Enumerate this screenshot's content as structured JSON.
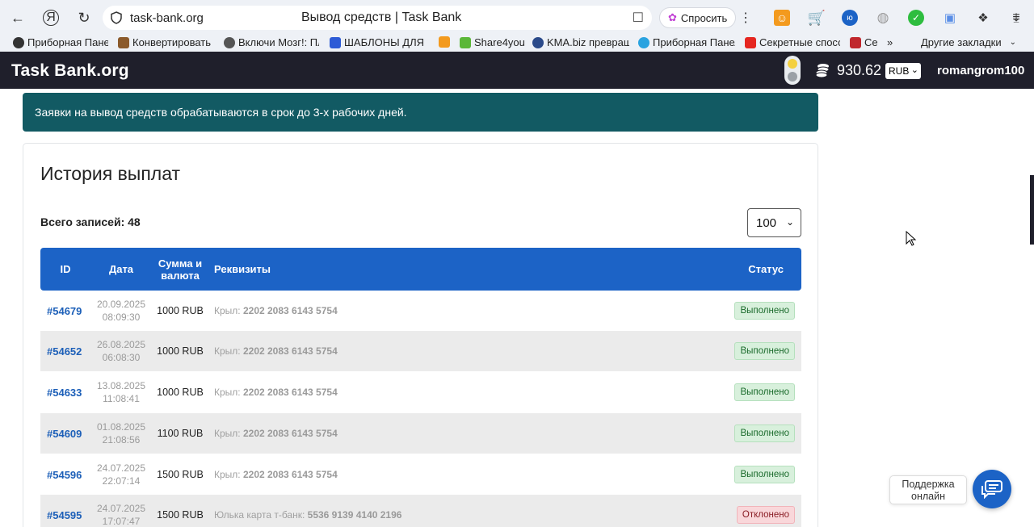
{
  "browser": {
    "url": "task-bank.org",
    "page_title": "Вывод средств | Task Bank",
    "ask_label": "Спросить",
    "bookmarks": [
      {
        "label": "Приборная Панел",
        "color": "#333333"
      },
      {
        "label": "Конвертировать",
        "color": "#8b5a2b"
      },
      {
        "label": "Включи Мозг!: Пл",
        "color": "#555555"
      },
      {
        "label": "ШАБЛОНЫ ДЛЯ Р",
        "color": "#2d5bd6"
      },
      {
        "label": "",
        "color": "#f39a1e"
      },
      {
        "label": "Share4you",
        "color": "#5bb738"
      },
      {
        "label": "KMA.biz превращ",
        "color": "#2b4a8a"
      },
      {
        "label": "Приборная Панел",
        "color": "#2aa3e0"
      },
      {
        "label": "Секретные спосо",
        "color": "#e52620"
      },
      {
        "label": "Се",
        "color": "#c0272d"
      }
    ],
    "more_bookmarks_label": "»",
    "other_bookmarks": "Другие закладки"
  },
  "header": {
    "logo": "Task Bank.org",
    "balance": "930.62",
    "currency": "RUB",
    "username": "romangrom100"
  },
  "alert": "Заявки на вывод средств обрабатываются в срок до 3-х рабочих дней.",
  "history": {
    "title": "История выплат",
    "total": "Всего записей: 48",
    "per_page": "100",
    "columns": {
      "id": "ID",
      "date": "Дата",
      "amount": "Сумма и валюта",
      "requisites": "Реквизиты",
      "status": "Статус"
    },
    "rows": [
      {
        "id": "#54679",
        "date": "20.09.2025",
        "time": "08:09:30",
        "amount": "1000 RUB",
        "req_label": "Крыл:",
        "req_value": "2202 2083 6143 5754",
        "status": "Выполнено",
        "status_type": "ok"
      },
      {
        "id": "#54652",
        "date": "26.08.2025",
        "time": "06:08:30",
        "amount": "1000 RUB",
        "req_label": "Крыл:",
        "req_value": "2202 2083 6143 5754",
        "status": "Выполнено",
        "status_type": "ok"
      },
      {
        "id": "#54633",
        "date": "13.08.2025",
        "time": "11:08:41",
        "amount": "1000 RUB",
        "req_label": "Крыл:",
        "req_value": "2202 2083 6143 5754",
        "status": "Выполнено",
        "status_type": "ok"
      },
      {
        "id": "#54609",
        "date": "01.08.2025",
        "time": "21:08:56",
        "amount": "1100 RUB",
        "req_label": "Крыл:",
        "req_value": "2202 2083 6143 5754",
        "status": "Выполнено",
        "status_type": "ok"
      },
      {
        "id": "#54596",
        "date": "24.07.2025",
        "time": "22:07:14",
        "amount": "1500 RUB",
        "req_label": "Крыл:",
        "req_value": "2202 2083 6143 5754",
        "status": "Выполнено",
        "status_type": "ok"
      },
      {
        "id": "#54595",
        "date": "24.07.2025",
        "time": "17:07:47",
        "amount": "1500 RUB",
        "req_label": "Юлька карта т-банк:",
        "req_value": "5536 9139 4140 2196",
        "status": "Отклонено",
        "status_type": "bad"
      }
    ]
  },
  "support": {
    "label_line1": "Поддержка",
    "label_line2": "онлайн"
  }
}
